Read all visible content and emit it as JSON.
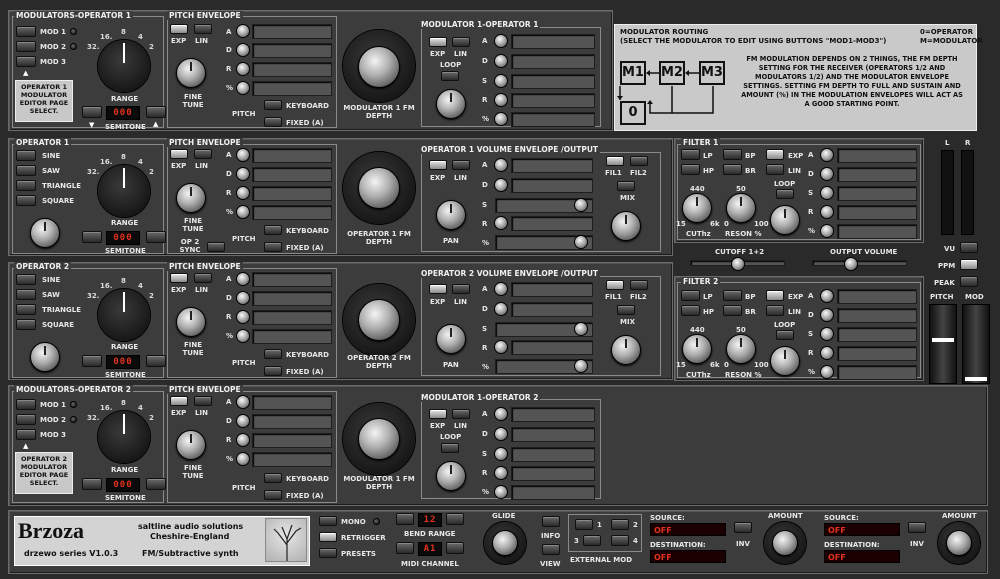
{
  "mod1": {
    "title": "MODULATORS-OPERATOR 1",
    "buttons": [
      "MOD 1",
      "MOD 2",
      "MOD 3"
    ],
    "info": "OPERATOR 1 MODULATOR EDITOR PAGE SELECT.",
    "range": "RANGE",
    "scale": [
      "32.",
      "16.",
      "8",
      "4",
      "2"
    ],
    "semitone": "SEMITONE",
    "semitone_value": "000",
    "pitch_env": "PITCH ENVELOPE",
    "exp": "EXP",
    "lin": "LIN",
    "fine_tune": "FINE TUNE",
    "env_labels": [
      "A",
      "D",
      "R",
      "%"
    ],
    "pitch": "PITCH",
    "keyboard": "KEYBOARD",
    "fixed": "FIXED (A)",
    "depth": "MODULATOR 1 FM DEPTH",
    "modop": "MODULATOR 1-OPERATOR 1",
    "loop": "LOOP",
    "adsr": [
      "A",
      "D",
      "S",
      "R",
      "%"
    ]
  },
  "routing": {
    "title": "MODULATOR ROUTING",
    "sub": "(SELECT THE MODULATOR TO EDIT USING BUTTONS \"MOD1-MOD3\")",
    "legend0": "0=OPERATOR",
    "legendM": "M=MODULATOR",
    "desc": "FM MODULATION DEPENDS ON 2 THINGS, THE FM DEPTH SETTING FOR THE RECEIVER (OPERATORS 1/2 AND MODULATORS 1/2) AND THE MODULATOR ENVELOPE SETTINGS. SETTING FM DEPTH TO FULL AND SUSTAIN AND AMOUNT (%) IN THE MODULATION ENVELOPES WILL ACT AS A GOOD STARTING POINT.",
    "nodes": [
      "M1",
      "M2",
      "M3",
      "0"
    ]
  },
  "op1": {
    "title": "OPERATOR 1",
    "waves": [
      "SINE",
      "SAW",
      "TRIANGLE",
      "SQUARE"
    ],
    "pitch_env": "PITCH ENVELOPE",
    "range": "RANGE",
    "semitone": "SEMITONE",
    "semitone_value": "000",
    "fine_tune": "FINE TUNE",
    "sync": "OP 2 SYNC",
    "keyboard": "KEYBOARD",
    "fixed": "FIXED (A)",
    "pitch": "PITCH",
    "depth": "OPERATOR 1 FM DEPTH",
    "vol_env": "OPERATOR 1 VOLUME ENVELOPE /OUTPUT",
    "fil1": "FIL1",
    "fil2": "FIL2",
    "mix": "MIX",
    "pan": "PAN"
  },
  "op2": {
    "title": "OPERATOR 2",
    "depth": "OPERATOR 2 FM DEPTH",
    "vol_env": "OPERATOR 2 VOLUME ENVELOPE /OUTPUT",
    "semitone_value": "000"
  },
  "filter1": {
    "title": "FILTER 1",
    "lp": "LP",
    "hp": "HP",
    "bp": "BP",
    "br": "BR",
    "exp": "EXP",
    "lin": "LIN",
    "loop": "LOOP",
    "cut_top": "440",
    "cut_low": "15",
    "cut_high": "6k",
    "cut": "CUThz",
    "res_top": "50",
    "res_low": "0",
    "res_high": "100",
    "reson": "RESON %"
  },
  "filter2": {
    "title": "FILTER 2"
  },
  "mixer": {
    "cutoff": "CUTOFF 1+2",
    "output": "OUTPUT VOLUME",
    "vu": "VU",
    "ppm": "PPM",
    "peak": "PEAK",
    "L": "L",
    "R": "R",
    "pitch": "PITCH",
    "mod": "MOD"
  },
  "mod2": {
    "title": "MODULATORS-OPERATOR 2",
    "info": "OPERATOR 2 MODULATOR EDITOR PAGE SELECT.",
    "depth": "MODULATOR 1 FM DEPTH",
    "modop": "MODULATOR 1-OPERATOR 2",
    "semitone_value": "000"
  },
  "footer": {
    "brand": "Brzoza",
    "series": "drzewo series V1.0.3",
    "maker": "saltline audio solutions",
    "loc": "Cheshire-England",
    "type": "FM/Subtractive synth",
    "mono": "MONO",
    "retrigger": "RETRIGGER",
    "presets": "PRESETS",
    "bend_value": "12",
    "bend_range": "BEND RANGE",
    "midi_value": "A1",
    "midi_channel": "MIDI CHANNEL",
    "glide": "GLIDE",
    "info": "INFO",
    "view": "VIEW",
    "ext_mod": "EXTERNAL MOD",
    "ext": [
      "1",
      "2",
      "3",
      "4"
    ],
    "source": "SOURCE:",
    "destination": "DESTINATION:",
    "off": "OFF",
    "inv": "INV",
    "amount": "AMOUNT"
  }
}
